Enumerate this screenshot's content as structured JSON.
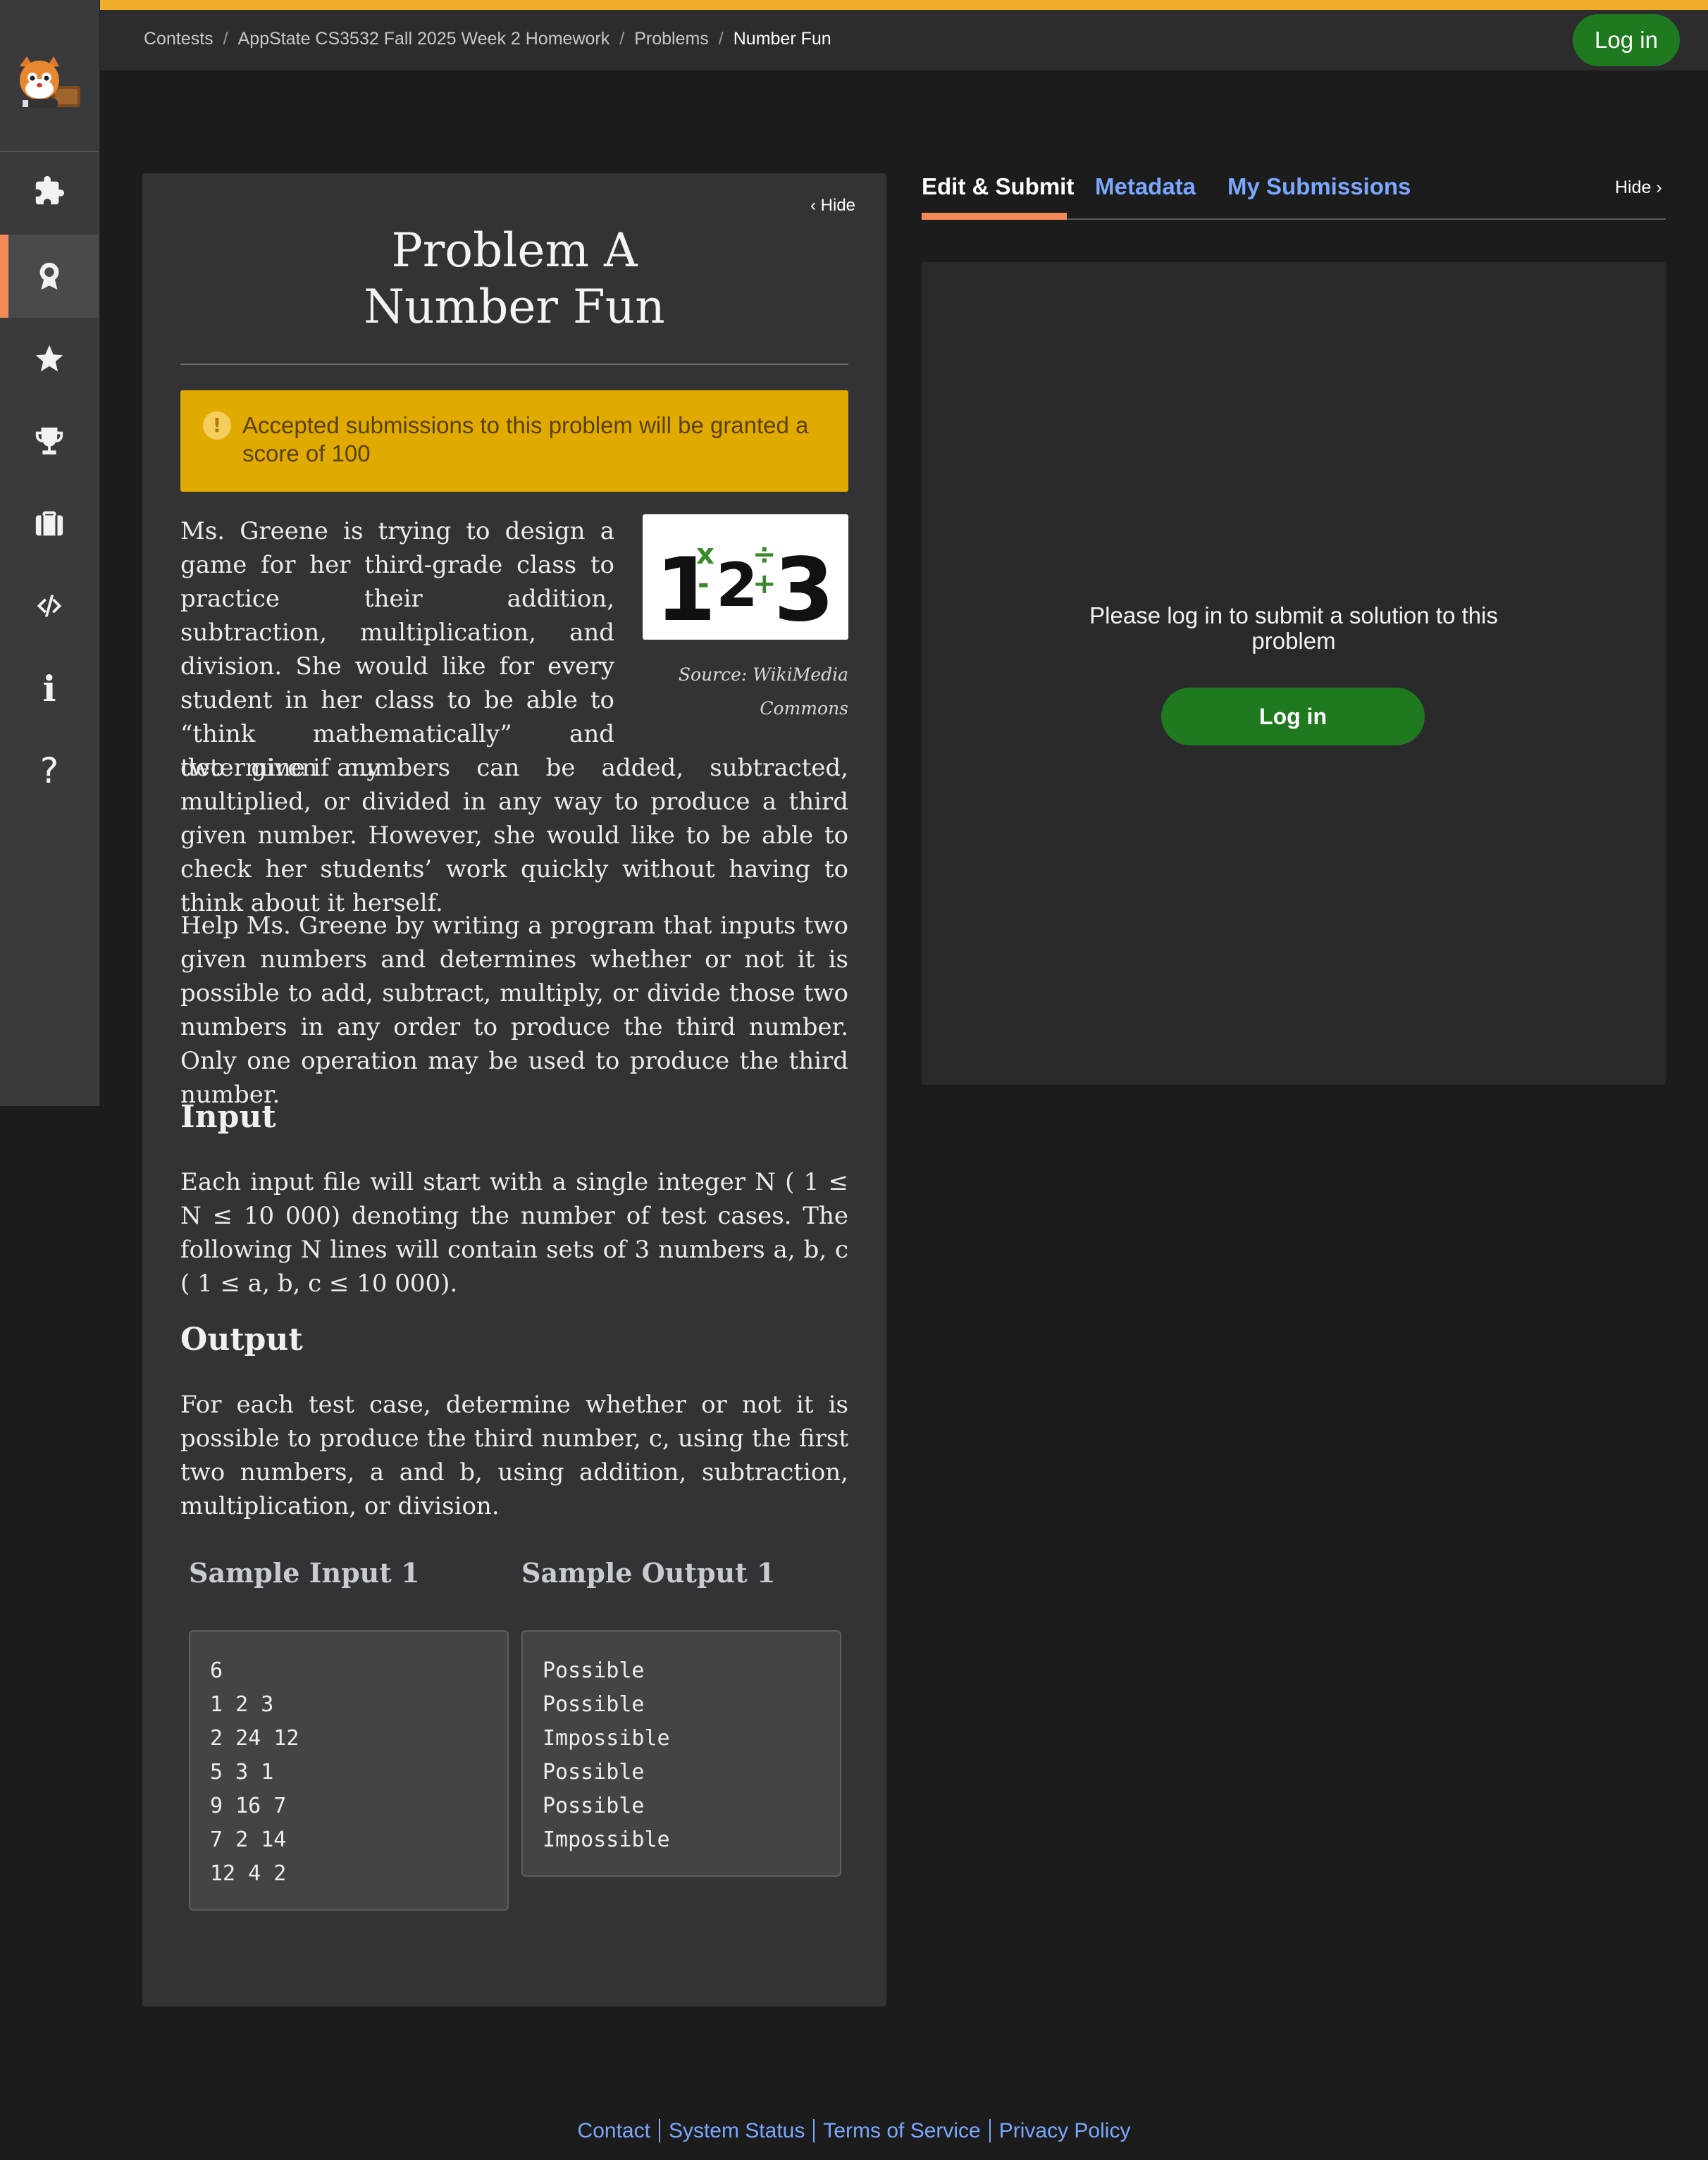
{
  "breadcrumb": {
    "contests": "Contests",
    "course": "AppState CS3532 Fall 2025 Week 2 Homework",
    "problems": "Problems",
    "current": "Number Fun"
  },
  "header": {
    "login_label": "Log in"
  },
  "sidebar": {
    "items": [
      {
        "icon": "puzzle-icon"
      },
      {
        "icon": "award-icon",
        "active": true
      },
      {
        "icon": "star-icon"
      },
      {
        "icon": "trophy-icon"
      },
      {
        "icon": "briefcase-icon"
      },
      {
        "icon": "code-icon"
      },
      {
        "icon": "info-icon",
        "glyph": "i"
      },
      {
        "icon": "help-icon",
        "glyph": "?"
      }
    ]
  },
  "problem": {
    "hide_label": "Hide",
    "title_line1": "Problem A",
    "title_line2": "Number Fun",
    "alert": "Accepted submissions to this problem will be granted a score of 100",
    "figure": {
      "n1": "1",
      "op_times": "x",
      "op_minus": "-",
      "n2": "2",
      "op_div": "÷",
      "op_plus": "+",
      "n3": "3",
      "caption": "Source: WikiMedia Commons"
    },
    "para1_part1": "Ms. Greene is trying to design a game for her third-grade class to practice their addition, subtraction, multiplication, and division. She would like for every student in her class to be able to “think mathematically” and determine if any",
    "para1_part2": "two given numbers can be added, subtracted, multiplied, or divided in any way to produce a third given number. However, she would like to be able to check her students’ work quickly without having to think about it herself.",
    "para2": "Help Ms. Greene by writing a program that inputs two given numbers and determines whether or not it is possible to add, subtract, multiply, or divide those two numbers in any order to produce the third number. Only one operation may be used to produce the third number.",
    "input_heading": "Input",
    "input_text": "Each input file will start with a single integer N ( 1 ≤ N ≤ 10 000) denoting the number of test cases. The following N lines will contain sets of 3 numbers a, b, c ( 1 ≤ a, b, c ≤ 10 000).",
    "output_heading": "Output",
    "output_text": "For each test case, determine whether or not it is possible to produce the third number, c, using the first two numbers, a and b, using addition, subtraction, multiplication, or division.",
    "sample_input_heading": "Sample Input 1",
    "sample_output_heading": "Sample Output 1",
    "sample_input": "6\n1 2 3\n2 24 12\n5 3 1\n9 16 7\n7 2 14\n12 4 2",
    "sample_output": "Possible\nPossible\nImpossible\nPossible\nPossible\nImpossible"
  },
  "tabs": {
    "edit": "Edit & Submit",
    "metadata": "Metadata",
    "submissions": "My Submissions",
    "hide_label": "Hide"
  },
  "submit": {
    "message": "Please log in to submit a solution to this problem",
    "login_label": "Log in"
  },
  "footer": {
    "contact": "Contact",
    "status": "System Status",
    "terms": "Terms of Service",
    "privacy": "Privacy Policy"
  },
  "colors": {
    "accent_orange": "#f28a57",
    "top_stripe": "#f0ad2a",
    "login_green": "#1f7a1f",
    "alert_yellow": "#e0aa00",
    "link_blue": "#7aa8ff",
    "figure_green": "#3a8a2a"
  }
}
